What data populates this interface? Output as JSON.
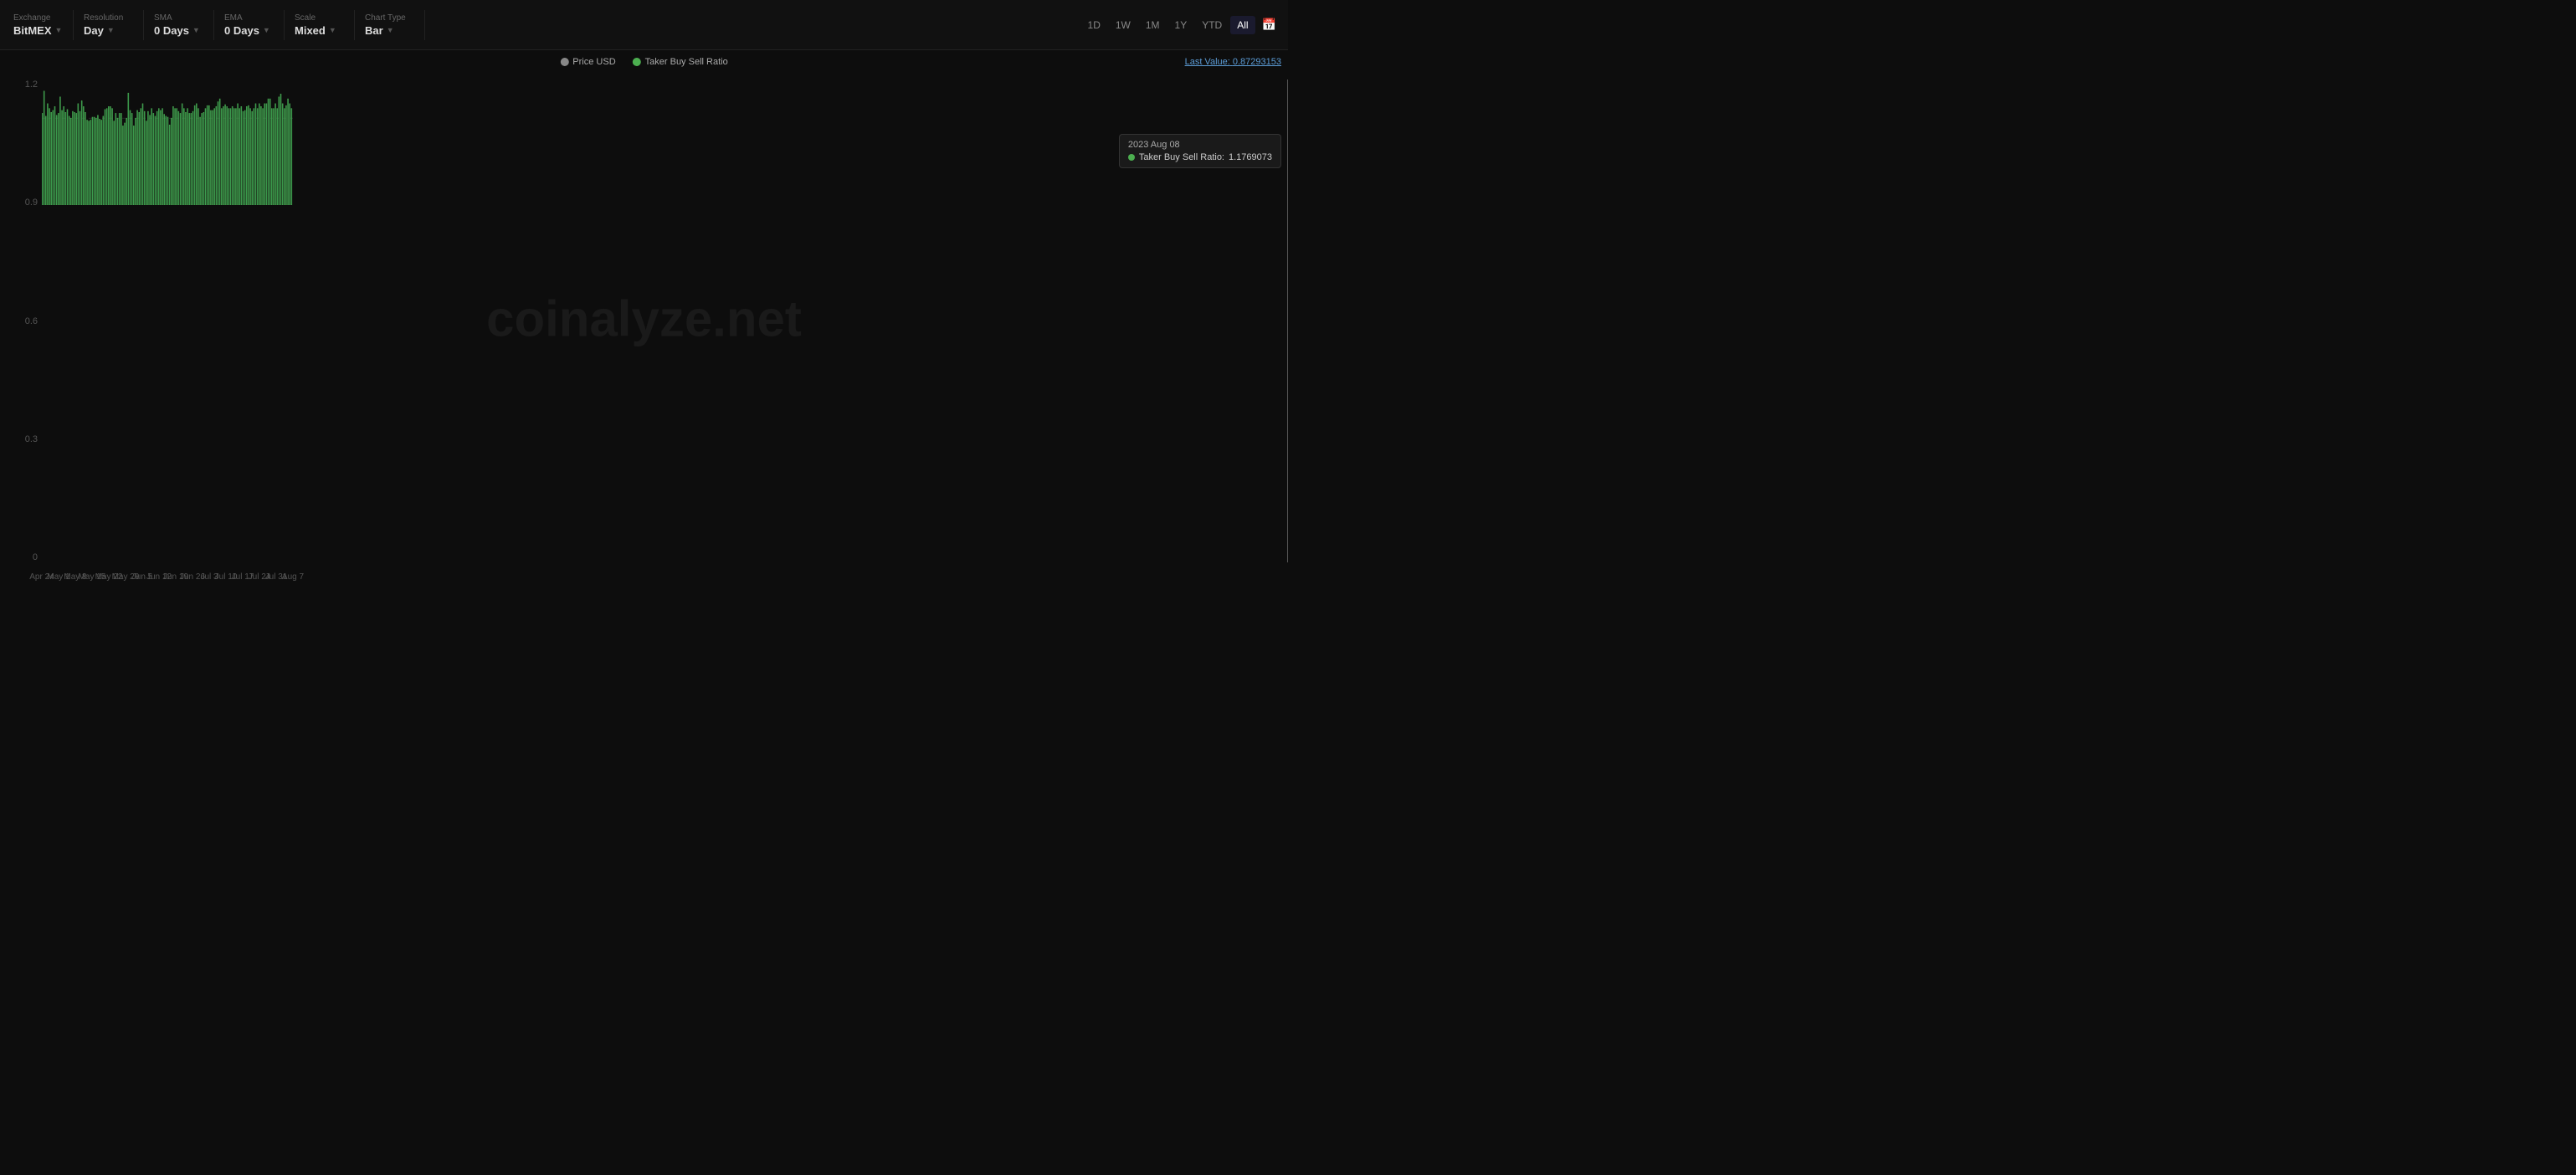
{
  "toolbar": {
    "exchange_label": "Exchange",
    "exchange_value": "BitMEX",
    "resolution_label": "Resolution",
    "resolution_value": "Day",
    "sma_label": "SMA",
    "sma_value": "0 Days",
    "ema_label": "EMA",
    "ema_value": "0 Days",
    "scale_label": "Scale",
    "scale_value": "Mixed",
    "chart_type_label": "Chart Type",
    "chart_type_value": "Bar"
  },
  "time_buttons": [
    "1D",
    "1W",
    "1M",
    "1Y",
    "YTD",
    "All"
  ],
  "active_time": "All",
  "legend": {
    "price_label": "Price USD",
    "ratio_label": "Taker Buy Sell Ratio"
  },
  "last_value": {
    "label": "Last Value:",
    "value": "0.87293153"
  },
  "tooltip": {
    "date": "2023 Aug 08",
    "ratio_label": "Taker Buy Sell Ratio:",
    "ratio_value": "1.1769073"
  },
  "y_axis": {
    "labels": [
      "1.2",
      "0.9",
      "0.6",
      "0.3",
      "0"
    ]
  },
  "x_axis": {
    "labels": [
      "Apr 24",
      "May 1",
      "May 8",
      "May 15",
      "May 22",
      "May 29",
      "Jun 5",
      "Jun 12",
      "Jun 19",
      "Jun 26",
      "Jul 3",
      "Jul 10",
      "Jul 17",
      "Jul 24",
      "Jul 31",
      "Aug 7"
    ]
  },
  "watermark": "coinalyze.net",
  "colors": {
    "bar_fill": "#3a9e5c",
    "bar_stroke": "#4caf50",
    "background": "#0d0d0d",
    "dashed": "#444"
  }
}
